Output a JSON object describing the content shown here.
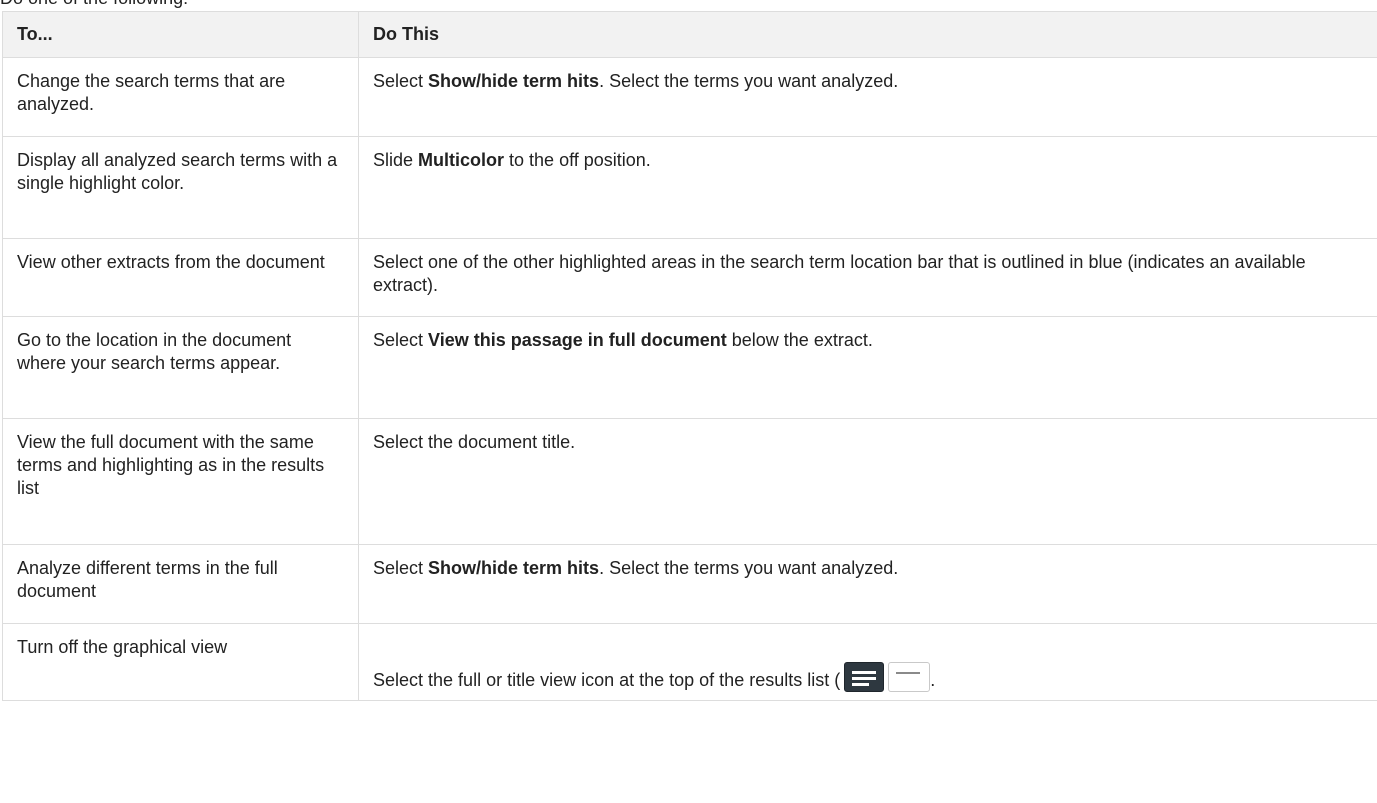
{
  "intro": "Do one of the following:",
  "headers": {
    "col1": "To...",
    "col2": "Do This"
  },
  "rows": [
    {
      "to": "Change the search terms that are analyzed.",
      "do_pre": "Select ",
      "do_bold": "Show/hide term hits",
      "do_post": ". Select the terms you want analyzed."
    },
    {
      "to": "Display all analyzed search terms with a single highlight color.",
      "do_pre": "Slide ",
      "do_bold": "Multicolor",
      "do_post": " to the off position."
    },
    {
      "to": "View other extracts from the document",
      "do_text": "Select one of the other highlighted areas in the search term location bar that is outlined in blue (indicates an available extract)."
    },
    {
      "to": "Go to the location in the document where your search terms appear.",
      "do_pre": "Select ",
      "do_bold": "View this passage in full document",
      "do_post": " below the extract."
    },
    {
      "to": "View the full document with the same terms and highlighting as in the results list",
      "do_text": "Select the document title."
    },
    {
      "to": "Analyze different terms in the full document",
      "do_pre": "Select ",
      "do_bold": "Show/hide term hits",
      "do_post": ". Select the terms you want analyzed."
    },
    {
      "to": "Turn off the graphical view",
      "do_pre": "Select the full or title view icon at the top of the results list (",
      "do_post": "."
    }
  ],
  "icons": {
    "full_view": "full-view-icon",
    "title_view": "title-view-icon"
  }
}
